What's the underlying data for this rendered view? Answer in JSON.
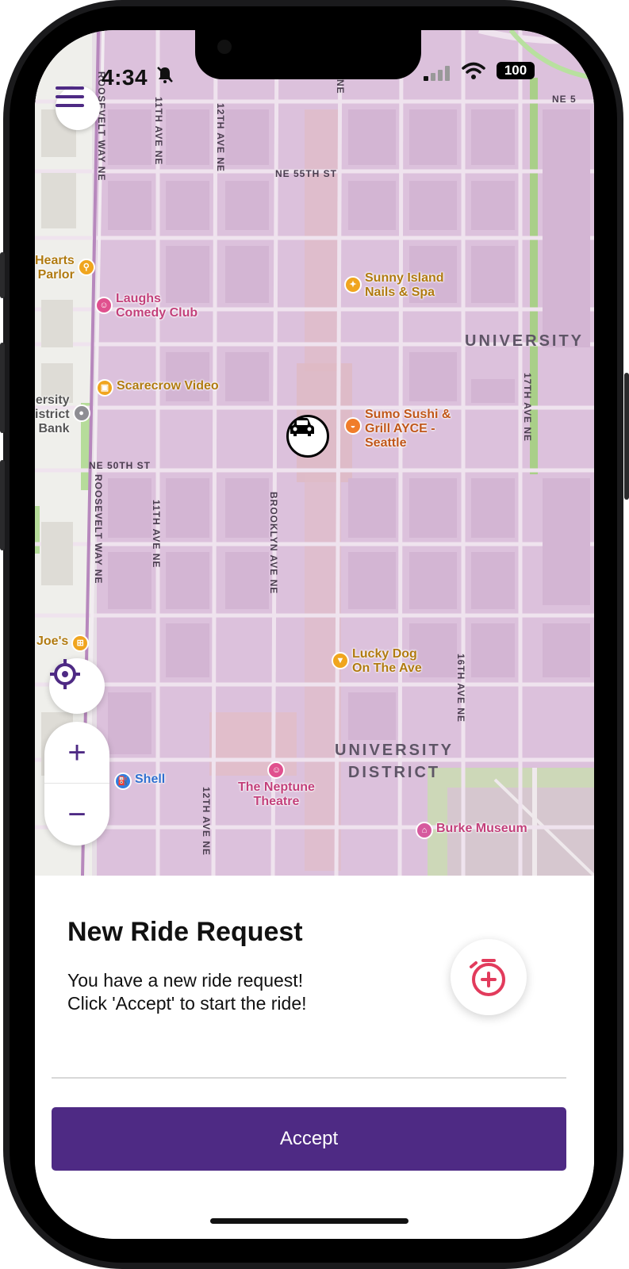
{
  "status_bar": {
    "time": "4:34",
    "battery": "100"
  },
  "map": {
    "streets": {
      "roosevelt_upper": "ROOSEVELT WAY NE",
      "roosevelt_lower": "ROOSEVELT WAY NE",
      "eleventh_upper": "11TH AVE NE",
      "eleventh_lower": "11TH AVE NE",
      "twelfth_upper": "12TH AVE NE",
      "twelfth_lower": "12TH AVE NE",
      "top_ne": "NE",
      "ne55": "NE 55TH ST",
      "ne50": "NE 50TH ST",
      "ne5_edge": "NE 5",
      "brooklyn": "BROOKLYN AVE NE",
      "seventeenth": "17TH AVE NE",
      "sixteenth": "16TH AVE NE"
    },
    "districts": {
      "university": "UNIVERSITY",
      "university_district": "UNIVERSITY\nDISTRICT"
    },
    "pois": {
      "hearts": "Hearts\nParlor",
      "sunny": "Sunny Island\nNails & Spa",
      "laughs": "Laughs\nComedy Club",
      "scarecrow": "Scarecrow Video",
      "bank": "ersity\nistrict\nBank",
      "sumo": "Sumo Sushi &\nGrill AYCE -\nSeattle",
      "joes": "Joe's",
      "lucky": "Lucky Dog\nOn The Ave",
      "shell": "Shell",
      "neptune": "The Neptune\nTheatre",
      "burke": "Burke Museum"
    },
    "poi_colors": {
      "shopping": "#f0a51e",
      "entertainment": "#e0508e",
      "food": "#f07d2a",
      "gas": "#2f7de0",
      "bank": "#8e8e93",
      "museum": "#d65a9e"
    },
    "controls": {
      "zoom_in": "+",
      "zoom_out": "−"
    }
  },
  "sheet": {
    "title": "New Ride Request",
    "message": "You have a new ride request!\nClick 'Accept' to start the ride!",
    "accept_label": "Accept"
  },
  "colors": {
    "accent": "#4e2a84",
    "map_fill": "#dcc1dc",
    "timer": "#e23b5c"
  },
  "icons": [
    "menu-icon",
    "locate-icon",
    "car-icon",
    "timer-cancel-icon",
    "bell-slash-icon",
    "signal-icon",
    "wifi-icon"
  ]
}
